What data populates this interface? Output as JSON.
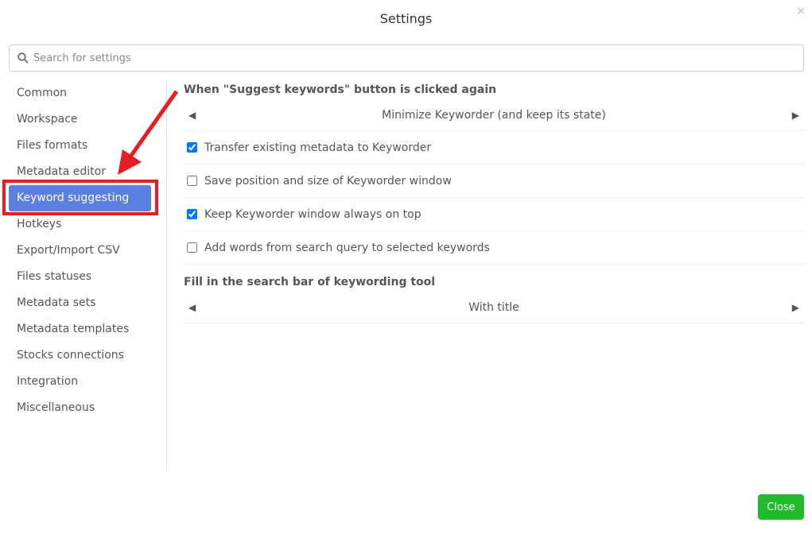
{
  "dialog": {
    "title": "Settings",
    "close_icon": "×"
  },
  "search": {
    "placeholder": "Search for settings",
    "value": ""
  },
  "sidebar": {
    "items": [
      {
        "label": "Common"
      },
      {
        "label": "Workspace"
      },
      {
        "label": "Files formats"
      },
      {
        "label": "Metadata editor"
      },
      {
        "label": "Keyword suggesting",
        "active": true
      },
      {
        "label": "Hotkeys"
      },
      {
        "label": "Export/Import CSV"
      },
      {
        "label": "Files statuses"
      },
      {
        "label": "Metadata sets"
      },
      {
        "label": "Metadata templates"
      },
      {
        "label": "Stocks connections"
      },
      {
        "label": "Integration"
      },
      {
        "label": "Miscellaneous"
      }
    ]
  },
  "main": {
    "section1": {
      "heading": "When \"Suggest keywords\" button is clicked again",
      "value": "Minimize Keyworder (and keep its state)"
    },
    "checkboxes": [
      {
        "label": "Transfer existing metadata to Keyworder",
        "checked": true
      },
      {
        "label": "Save position and size of Keyworder window",
        "checked": false
      },
      {
        "label": "Keep Keyworder window always on top",
        "checked": true
      },
      {
        "label": "Add words from search query to selected keywords",
        "checked": false
      }
    ],
    "section2": {
      "heading": "Fill in the search bar of keywording tool",
      "value": "With title"
    }
  },
  "footer": {
    "close_label": "Close"
  },
  "colors": {
    "accent": "#5b7fe0",
    "close_button": "#1fbb2a",
    "annotation": "#e81c24"
  }
}
